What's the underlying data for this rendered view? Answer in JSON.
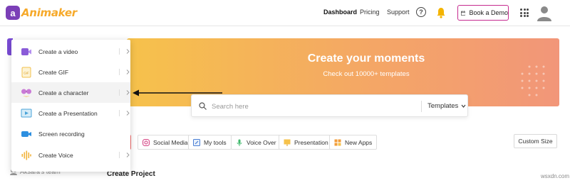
{
  "header": {
    "logo_text": "Animaker",
    "nav": [
      {
        "label": "Dashboard",
        "active": true
      },
      {
        "label": "Pricing",
        "active": false
      },
      {
        "label": "Support",
        "active": false
      }
    ],
    "help_label": "?",
    "book_demo_label": "Book a Demo"
  },
  "banner": {
    "title": "Create your moments",
    "subtitle": "Check out 10000+ templates"
  },
  "search": {
    "placeholder": "Search here",
    "value": "",
    "category": "Templates"
  },
  "chips": [
    {
      "label": "Social Media",
      "icon": "instagram-icon"
    },
    {
      "label": "My tools",
      "icon": "tools-icon"
    },
    {
      "label": "Voice Over",
      "icon": "microphone-icon"
    },
    {
      "label": "Presentation",
      "icon": "presentation-icon"
    },
    {
      "label": "New Apps",
      "icon": "apps-icon"
    }
  ],
  "custom_size_label": "Custom Size",
  "create_project_title": "Create Project",
  "sidebar": {
    "team_label": "Aksara's team"
  },
  "menu": {
    "items": [
      {
        "label": "Create a video",
        "icon": "video-camera-icon",
        "has_submenu": true
      },
      {
        "label": "Create GIF",
        "icon": "gif-icon",
        "has_submenu": true
      },
      {
        "label": "Create a character",
        "icon": "character-icon",
        "has_submenu": true,
        "highlighted": true
      },
      {
        "label": "Create a Presentation",
        "icon": "presentation-icon",
        "has_submenu": true
      },
      {
        "label": "Screen recording",
        "icon": "screen-recording-icon",
        "has_submenu": false
      },
      {
        "label": "Create Voice",
        "icon": "voice-wave-icon",
        "has_submenu": true
      }
    ]
  },
  "watermark": "wsxdn.com",
  "colors": {
    "brand_purple": "#7b3fb7",
    "logo_orange": "#f6a92a",
    "banner_start": "#f6c24b",
    "banner_end": "#f29679",
    "demo_border": "#c62a8f"
  }
}
